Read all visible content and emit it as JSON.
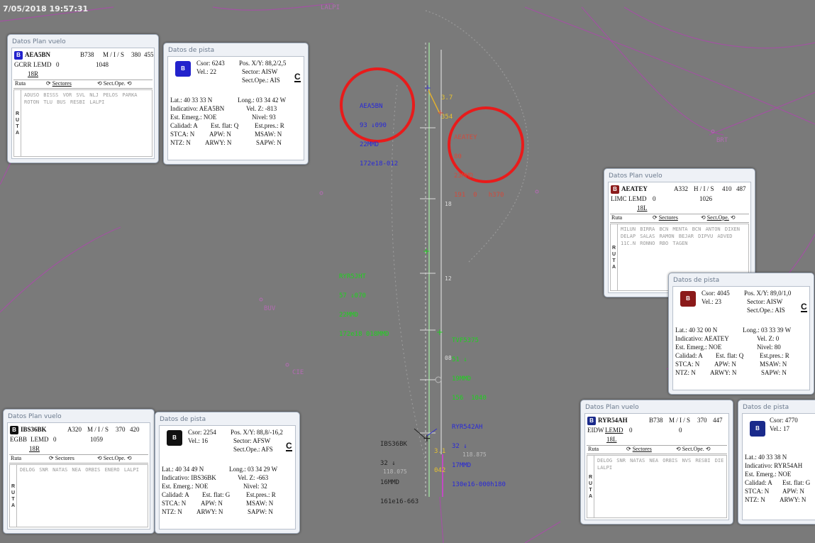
{
  "timestamp": "7/05/2018 19:57:31",
  "radar": {
    "fixes": [
      "LALPI",
      "BUV",
      "CIE",
      "BRT"
    ],
    "tracks": [
      {
        "id": "AEA5BN",
        "lines": [
          "AEA5BN",
          "93 ↓090",
          "22MMD",
          "172e18-012"
        ],
        "color": "#2828d8"
      },
      {
        "id": "AEATEY",
        "lines": [
          "AEATEY",
          "80",
          "23MMD",
          "191  0   h370"
        ],
        "color": "#d24a3c"
      },
      {
        "id": "g1",
        "lines": [
          "RYR5JHT",
          "57 ↓070",
          "22MMD",
          "172e18 018MMD"
        ],
        "color": "#1fd21f"
      },
      {
        "id": "g2",
        "lines": [
          "TVF5375",
          "51 ↓",
          "19MMD",
          "156  1040"
        ],
        "color": "#1fd21f"
      },
      {
        "id": "RYR542AH",
        "lines": [
          "RYR542AH",
          "32 ↓",
          "17MMD",
          "130e16-000h180"
        ],
        "color": "#2828d8"
      },
      {
        "id": "IBS36BK",
        "lines": [
          "IBS36BK",
          "32 ↓",
          "16MMD",
          "161e16-663"
        ],
        "color": "#222"
      }
    ],
    "yellow_tags": [
      {
        "lines": [
          "3.7",
          "354"
        ]
      },
      {
        "lines": [
          "3.1",
          "042"
        ]
      }
    ],
    "scale_labels": [
      "18",
      "12",
      "08",
      "118.875",
      "118.075"
    ]
  },
  "flight_plans": [
    {
      "title": "Datos Plan vuelo",
      "callsign": "AEA5BN",
      "type": "B738",
      "rules": "M / I / S",
      "fl": "380",
      "speed": "455",
      "origin": "GCRR",
      "dest": "LEMD",
      "v0": "0",
      "squawk": "1048",
      "runway": "18R",
      "tabs": [
        "Ruta",
        "Sectores",
        "Sect.Ope."
      ],
      "route": "ADUSO BISSS VOR SVL NLJ PELOS PARKA ROTON TLU BUS RESBI LALPI",
      "color": "#2222cc",
      "route_letters": [
        "R",
        "U",
        "T",
        "A"
      ]
    },
    {
      "title": "Datos Plan vuelo",
      "callsign": "AEATEY",
      "type": "A332",
      "rules": "H / I / S",
      "fl": "410",
      "speed": "487",
      "origin": "LIMC",
      "dest": "LEMD",
      "v0": "0",
      "squawk": "1026",
      "runway": "18L",
      "tabs": [
        "Ruta",
        "Sectores",
        "Sect.Ope."
      ],
      "route": "MILUN BIRRA BCN MENTA BCN ANTON DIXEN DELAP SALAS RAMON BEJAR DIPVU ADVED 11C.N RONNO RBO TAGEN",
      "color": "#8b1a1a",
      "route_letters": [
        "R",
        "U",
        "T",
        "A"
      ]
    },
    {
      "title": "Datos Plan vuelo",
      "callsign": "IBS36BK",
      "type": "A320",
      "rules": "M / I / S",
      "fl": "370",
      "speed": "420",
      "origin": "EGBB",
      "dest": "LEMD",
      "v0": "0",
      "squawk": "1059",
      "runway": "18R",
      "tabs": [
        "Ruta",
        "Sectores",
        "Sect.Ope."
      ],
      "route": "DELOG SNR NATAS NEA ORBIS ENERO LALPI",
      "color": "#111111",
      "route_letters": [
        "R",
        "U",
        "T",
        "A"
      ]
    },
    {
      "title": "Datos Plan vuelo",
      "callsign": "RYR54AH",
      "type": "B738",
      "rules": "M / I / S",
      "fl": "370",
      "speed": "447",
      "origin": "EIDW",
      "dest": "LEMD",
      "v0": "0",
      "squawk": "0",
      "runway": "18L",
      "tabs": [
        "Ruta",
        "Sectores",
        "Sect.Ope."
      ],
      "route": "DELOG SNR NATAS NEA ORBIS NVS RESBI DIE LALPI",
      "color": "#1a2a8b",
      "route_letters": [
        "R",
        "U",
        "T",
        "A"
      ]
    }
  ],
  "track_panels": [
    {
      "title": "Datos de pista",
      "csor": "Csor: 6243",
      "pos": "Pos. X/Y: 88,2/2,5",
      "vel": "Vel.: 22",
      "sector": "Sector: AISW",
      "sectope": "Sect.Ope.: AIS",
      "lat": "Lat.: 40 33 33 N",
      "long": "Long.: 03 34 42 W",
      "indicativo": "Indicativo: AEA5BN",
      "velz": "Vel. Z: -813",
      "emerg": "Est. Emerg.: NOE",
      "nivel": "Nivel: 93",
      "calidad": "Calidad: A",
      "estflat": "Est. flat: Q",
      "estpres": "Est.pres.: R",
      "stca": "STCA: N",
      "apw": "APW: N",
      "msaw": "MSAW: N",
      "ntz": "NTZ: N",
      "arwy": "ARWY: N",
      "sapw": "SAPW: N",
      "c": "C",
      "color": "#2222cc"
    },
    {
      "title": "Datos de pista",
      "csor": "Csor: 4045",
      "pos": "Pos. X/Y: 89,0/1,0",
      "vel": "Vel.: 23",
      "sector": "Sector: AISW",
      "sectope": "Sect.Ope.: AIS",
      "lat": "Lat.: 40 32 00 N",
      "long": "Long.: 03 33 39 W",
      "indicativo": "Indicativo: AEATEY",
      "velz": "Vel. Z: 0",
      "emerg": "Est. Emerg.: NOE",
      "nivel": "Nivel: 80",
      "calidad": "Calidad: A",
      "estflat": "Est. flat: Q",
      "estpres": "Est.pres.: R",
      "stca": "STCA: N",
      "apw": "APW: N",
      "msaw": "MSAW: N",
      "ntz": "NTZ: N",
      "arwy": "ARWY: N",
      "sapw": "SAPW: N",
      "c": "C",
      "color": "#8b1a1a"
    },
    {
      "title": "Datos de pista",
      "csor": "Csor: 2254",
      "pos": "Pos. X/Y: 88,8/-16,2",
      "vel": "Vel.: 16",
      "sector": "Sector: AFSW",
      "sectope": "Sect.Ope.: AFS",
      "lat": "Lat.: 40 34 49 N",
      "long": "Long.: 03 34 29 W",
      "indicativo": "Indicativo: IBS36BK",
      "velz": "Vel. Z: -663",
      "emerg": "Est. Emerg.: NOE",
      "nivel": "Nivel: 32",
      "calidad": "Calidad: A",
      "estflat": "Est. flat: G",
      "estpres": "Est.pres.: R",
      "stca": "STCA: N",
      "apw": "APW: N",
      "msaw": "MSAW: N",
      "ntz": "NTZ: N",
      "arwy": "ARWY: N",
      "sapw": "SAPW: N",
      "c": "C",
      "color": "#111111"
    },
    {
      "title": "Datos de pista",
      "csor": "Csor: 4770",
      "pos": "Pos.",
      "vel": "Vel.: 17",
      "sector": "Sect",
      "sectope": "Sect",
      "lat": "Lat.: 40 33 38 N",
      "long": "Lo",
      "indicativo": "Indicativo: RYR54AH",
      "velz": "",
      "emerg": "Est. Emerg.: NOE",
      "nivel": "",
      "calidad": "Calidad: A",
      "estflat": "Est. flat: G",
      "estpres": "",
      "stca": "STCA: N",
      "apw": "APW: N",
      "msaw": "",
      "ntz": "NTZ: N",
      "arwy": "ARWY: N",
      "sapw": "",
      "c": "",
      "color": "#1a2a8b"
    }
  ]
}
